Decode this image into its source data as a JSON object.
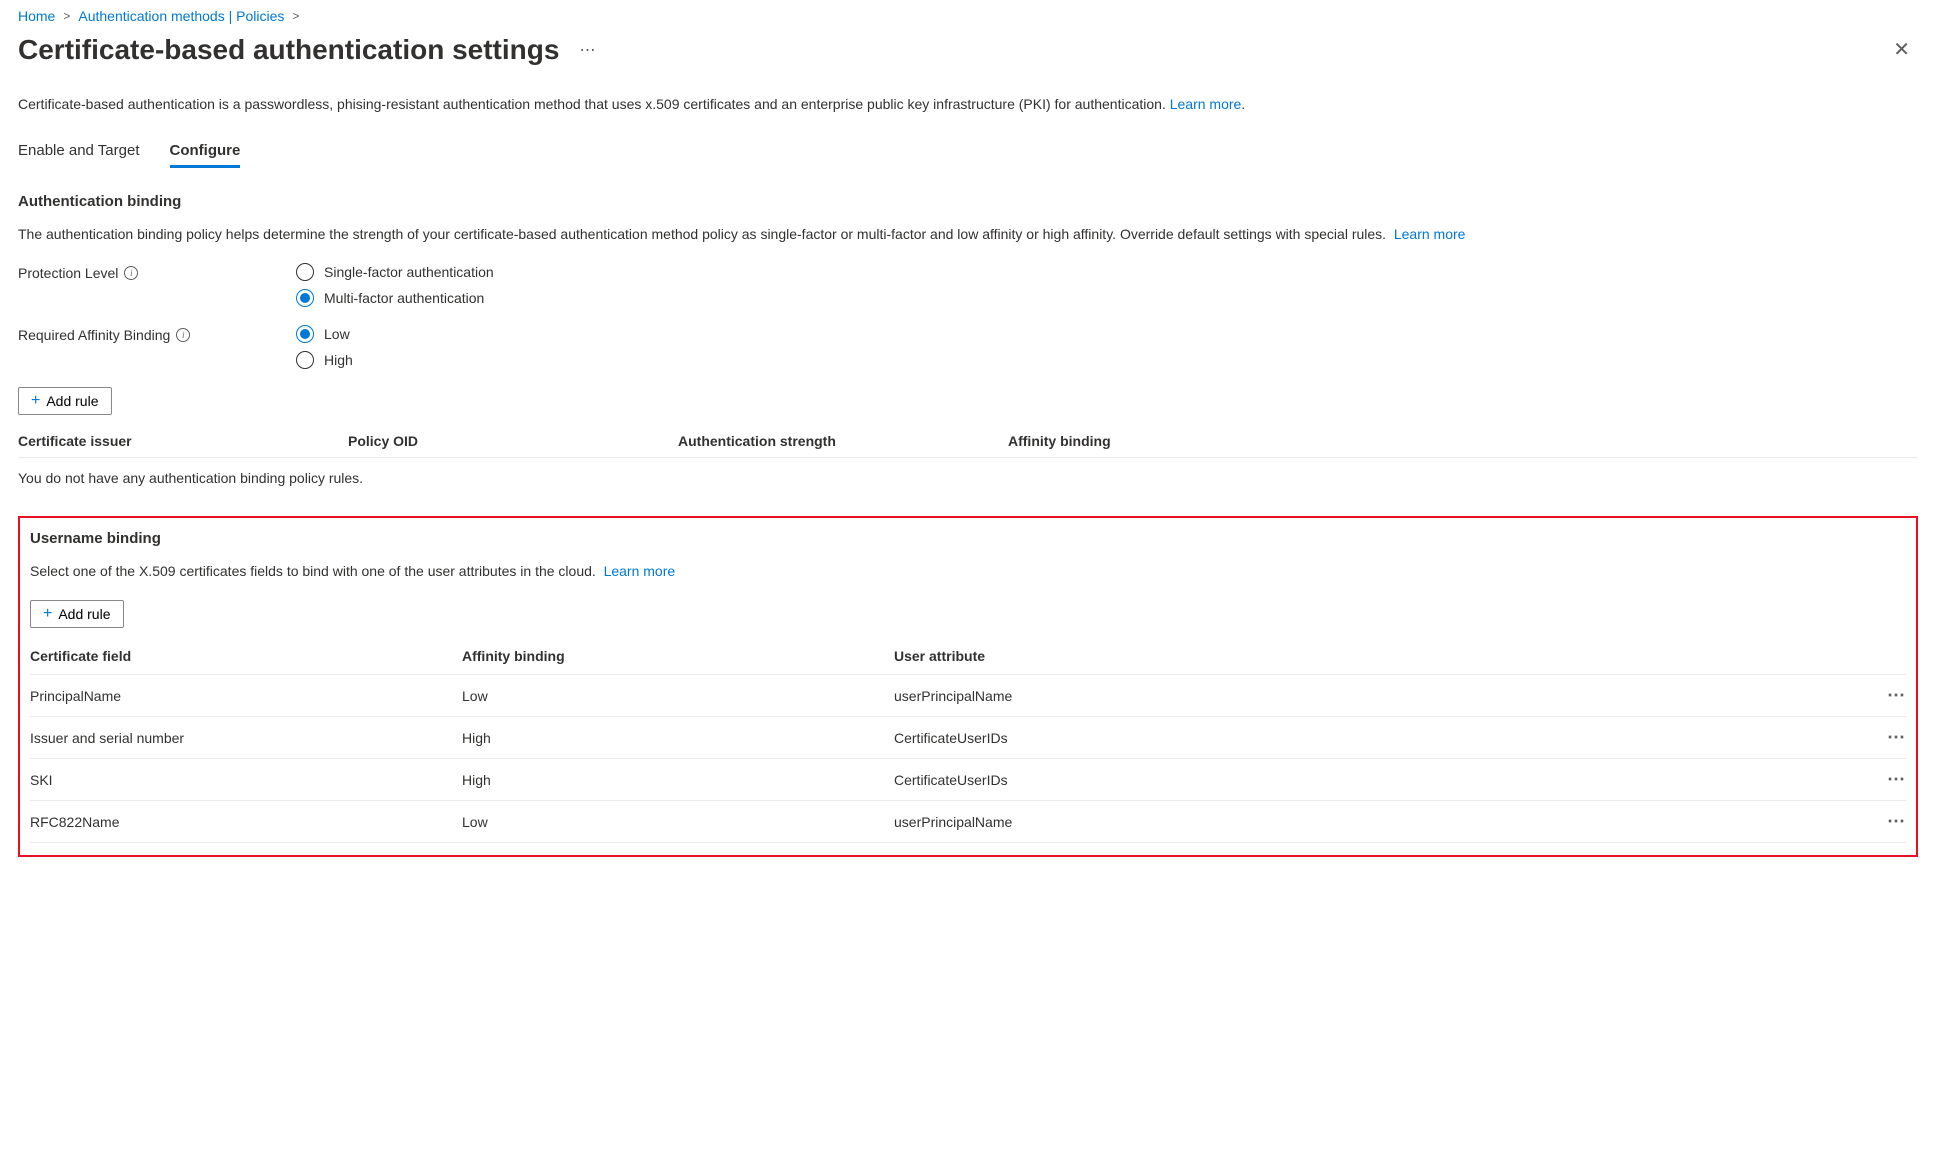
{
  "breadcrumb": {
    "home": "Home",
    "authMethods": "Authentication methods | Policies"
  },
  "page": {
    "title": "Certificate-based authentication settings",
    "description": "Certificate-based authentication is a passwordless, phising-resistant authentication method that uses x.509 certificates and an enterprise public key infrastructure (PKI) for authentication.",
    "learnMore": "Learn more"
  },
  "tabs": {
    "enableTarget": "Enable and Target",
    "configure": "Configure"
  },
  "authBinding": {
    "title": "Authentication binding",
    "description": "The authentication binding policy helps determine the strength of your certificate-based authentication method policy as single-factor or multi-factor and low affinity or high affinity. Override default settings with special rules.",
    "learnMore": "Learn more",
    "protectionLevel": {
      "label": "Protection Level",
      "options": {
        "single": "Single-factor authentication",
        "multi": "Multi-factor authentication"
      }
    },
    "affinity": {
      "label": "Required Affinity Binding",
      "options": {
        "low": "Low",
        "high": "High"
      }
    },
    "addRule": "Add rule",
    "columns": {
      "issuer": "Certificate issuer",
      "oid": "Policy OID",
      "strength": "Authentication strength",
      "affinity": "Affinity binding"
    },
    "emptyMessage": "You do not have any authentication binding policy rules."
  },
  "usernameBinding": {
    "title": "Username binding",
    "description": "Select one of the X.509 certificates fields to bind with one of the user attributes in the cloud.",
    "learnMore": "Learn more",
    "addRule": "Add rule",
    "columns": {
      "field": "Certificate field",
      "affinity": "Affinity binding",
      "attr": "User attribute"
    },
    "rows": [
      {
        "field": "PrincipalName",
        "affinity": "Low",
        "attr": "userPrincipalName"
      },
      {
        "field": "Issuer and serial number",
        "affinity": "High",
        "attr": "CertificateUserIDs"
      },
      {
        "field": "SKI",
        "affinity": "High",
        "attr": "CertificateUserIDs"
      },
      {
        "field": "RFC822Name",
        "affinity": "Low",
        "attr": "userPrincipalName"
      }
    ]
  }
}
